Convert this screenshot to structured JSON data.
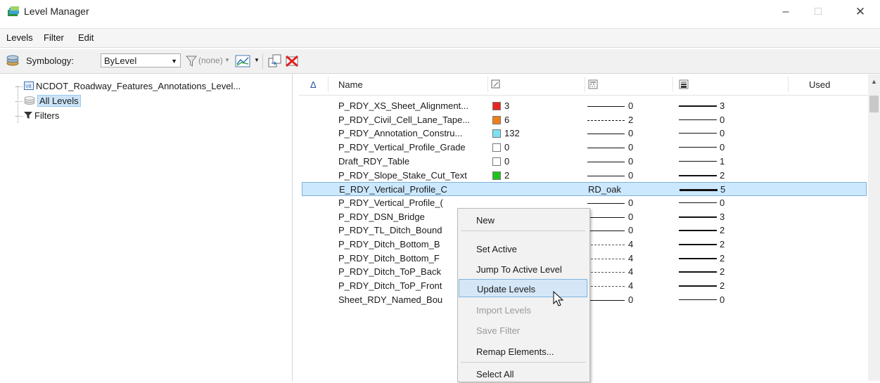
{
  "window": {
    "title": "Level Manager",
    "controls": {
      "minimize": "–",
      "maximize": "□",
      "close": "✕"
    }
  },
  "menubar": {
    "items": [
      {
        "label": "Levels"
      },
      {
        "label": "Filter"
      },
      {
        "label": "Edit"
      }
    ]
  },
  "toolbar": {
    "symbology_label": "Symbology:",
    "symbology_value": "ByLevel",
    "filter_value": "(none)"
  },
  "tree": {
    "root": "NCDOT_Roadway_Features_Annotations_Level...",
    "items": [
      "All Levels",
      "Filters"
    ],
    "selected": "All Levels"
  },
  "columns": {
    "sort_glyph": "Δ",
    "name": "Name",
    "used": "Used"
  },
  "rows": [
    {
      "name": "P_RDY_XS_Sheet_Alignment...",
      "color": "#e8261f",
      "color_num": "3",
      "style": "0",
      "style_kind": "solid",
      "weight": "3"
    },
    {
      "name": "P_RDY_Civil_Cell_Lane_Tape...",
      "color": "#ee7f18",
      "color_num": "6",
      "style": "2",
      "style_kind": "dash",
      "weight": "0"
    },
    {
      "name": "P_RDY_Annotation_Constru...",
      "color": "#7fe0f2",
      "color_num": "132",
      "style": "0",
      "style_kind": "solid",
      "weight": "0"
    },
    {
      "name": "P_RDY_Vertical_Profile_Grade",
      "color": "#ffffff",
      "color_num": "0",
      "style": "0",
      "style_kind": "solid",
      "weight": "0"
    },
    {
      "name": "Draft_RDY_Table",
      "color": "#ffffff",
      "color_num": "0",
      "style": "0",
      "style_kind": "solid",
      "weight": "1"
    },
    {
      "name": "P_RDY_Slope_Stake_Cut_Text",
      "color": "#1ec41e",
      "color_num": "2",
      "style": "0",
      "style_kind": "solid",
      "weight": "2"
    },
    {
      "name": "E_RDY_Vertical_Profile_C",
      "color": "",
      "color_num": "",
      "style": "RD_oak",
      "style_kind": "text",
      "weight": "5"
    },
    {
      "name": "P_RDY_Vertical_Profile_(",
      "color": "",
      "color_num": "",
      "style": "0",
      "style_kind": "solid",
      "weight": "0"
    },
    {
      "name": "P_RDY_DSN_Bridge",
      "color": "",
      "color_num": "",
      "style": "0",
      "style_kind": "solid",
      "weight": "3"
    },
    {
      "name": "P_RDY_TL_Ditch_Bound",
      "color": "",
      "color_num": "",
      "style": "0",
      "style_kind": "solid",
      "weight": "2"
    },
    {
      "name": "P_RDY_Ditch_Bottom_B",
      "color": "",
      "color_num": "",
      "style": "4",
      "style_kind": "dashdot",
      "weight": "2"
    },
    {
      "name": "P_RDY_Ditch_Bottom_F",
      "color": "",
      "color_num": "",
      "style": "4",
      "style_kind": "dashdot",
      "weight": "2"
    },
    {
      "name": "P_RDY_Ditch_ToP_Back",
      "color": "",
      "color_num": "",
      "style": "4",
      "style_kind": "dashdot",
      "weight": "2"
    },
    {
      "name": "P_RDY_Ditch_ToP_Front",
      "color": "",
      "color_num": "",
      "style": "4",
      "style_kind": "dashdot",
      "weight": "2"
    },
    {
      "name": "Sheet_RDY_Named_Bou",
      "color": "",
      "color_num": "",
      "style": "0",
      "style_kind": "solid",
      "weight": "0"
    }
  ],
  "selected_row": 6,
  "context_menu": {
    "items": [
      {
        "label": "New",
        "state": "normal"
      },
      {
        "label": "Set Active",
        "state": "normal"
      },
      {
        "label": "Jump To Active Level",
        "state": "normal"
      },
      {
        "label": "Update Levels",
        "state": "highlighted"
      },
      {
        "label": "Import Levels",
        "state": "disabled"
      },
      {
        "label": "Save Filter",
        "state": "disabled"
      },
      {
        "label": "Remap Elements...",
        "state": "normal"
      },
      {
        "label": "Select All",
        "state": "normal"
      }
    ]
  },
  "colors": {
    "selection": "#cce8ff",
    "menu_highlight": "#d5e7f7"
  }
}
